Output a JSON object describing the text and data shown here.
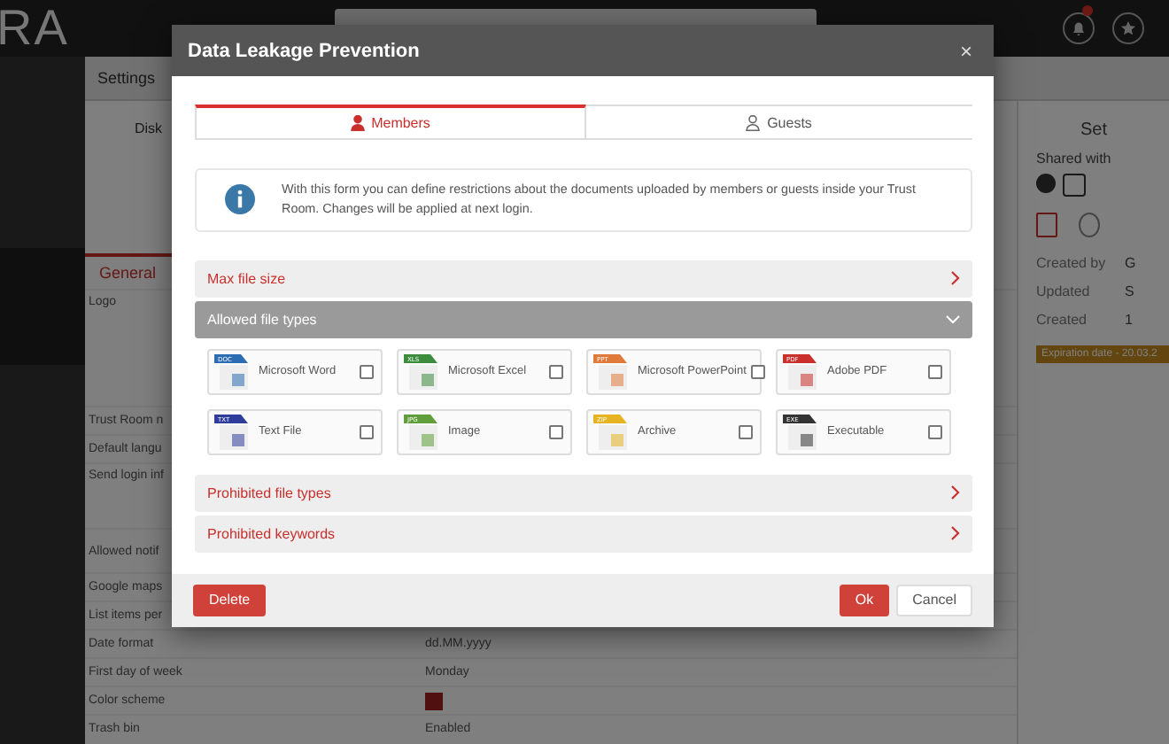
{
  "app": {
    "logo": "RA",
    "notifications_badge": true
  },
  "main": {
    "header": "Settings",
    "left_heading": "Disk",
    "tab": "General",
    "rows": [
      {
        "kind": "text",
        "label": "Logo",
        "value": ""
      },
      {
        "kind": "text",
        "label": "Trust Room n",
        "value": ""
      },
      {
        "kind": "text",
        "label": "Default langu",
        "value": ""
      },
      {
        "kind": "text",
        "label": "Send login inf",
        "value": ""
      },
      {
        "kind": "text",
        "label": "Allowed notif",
        "value": ""
      },
      {
        "kind": "text",
        "label": "Google maps",
        "value": ""
      },
      {
        "kind": "text",
        "label": "List items per",
        "value": ""
      },
      {
        "kind": "text",
        "label": "Date format",
        "value": "dd.MM.yyyy"
      },
      {
        "kind": "text",
        "label": "First day of week",
        "value": "Monday"
      },
      {
        "kind": "swatch",
        "label": "Color scheme",
        "value": ""
      },
      {
        "kind": "text",
        "label": "Trash bin",
        "value": "Enabled"
      }
    ]
  },
  "side": {
    "heading": "Set",
    "shared_with": "Shared with",
    "details": [
      {
        "label": "Created by",
        "value": "G"
      },
      {
        "label": "Updated",
        "value": "S"
      },
      {
        "label": "Created",
        "value": "1"
      }
    ],
    "expiration": "Expiration date - 20.03.2"
  },
  "modal": {
    "title": "Data Leakage Prevention",
    "close": "×",
    "tabs": [
      {
        "label": "Members",
        "selected": true
      },
      {
        "label": "Guests",
        "selected": false
      }
    ],
    "info": "With this form you can define restrictions about the documents uploaded by members or guests inside your Trust Room. Changes will be applied at next login.",
    "sections": [
      {
        "title": "Max file size",
        "expanded": false
      },
      {
        "title": "Allowed file types",
        "expanded": true,
        "file_types": [
          {
            "tag": "DOC",
            "label": "Microsoft Word",
            "color": "#2b6cb3",
            "checked": false
          },
          {
            "tag": "XLS",
            "label": "Microsoft Excel",
            "color": "#3d8b3d",
            "checked": false
          },
          {
            "tag": "PPT",
            "label": "Microsoft PowerPoint",
            "color": "#e07a3a",
            "checked": false
          },
          {
            "tag": "PDF",
            "label": "Adobe PDF",
            "color": "#c9302c",
            "checked": false
          },
          {
            "tag": "TXT",
            "label": "Text File",
            "color": "#2e3d9a",
            "checked": false
          },
          {
            "tag": "JPG",
            "label": "Image",
            "color": "#5f9e3a",
            "checked": false
          },
          {
            "tag": "ZIP",
            "label": "Archive",
            "color": "#e6b422",
            "checked": false
          },
          {
            "tag": "EXE",
            "label": "Executable",
            "color": "#333333",
            "checked": false
          }
        ]
      },
      {
        "title": "Prohibited file types",
        "expanded": false
      },
      {
        "title": "Prohibited keywords",
        "expanded": false
      }
    ],
    "buttons": {
      "delete": "Delete",
      "ok": "Ok",
      "cancel": "Cancel"
    }
  }
}
